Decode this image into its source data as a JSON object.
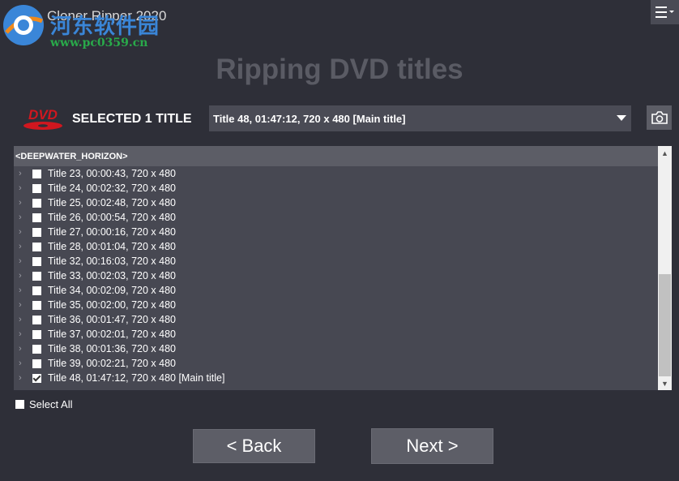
{
  "app": {
    "title": "Cloner Ripper 2020",
    "watermark_cn": "河东软件园",
    "watermark_url": "www.pc0359.cn",
    "menu_icon": "hamburger-menu-icon"
  },
  "page": {
    "heading": "Ripping DVD titles",
    "selected_label": "SELECTED 1 TITLE",
    "dropdown_value": "Title 48, 01:47:12, 720 x 480 [Main title]",
    "camera_icon": "camera-icon",
    "dvd_logo_text": "DVD"
  },
  "list": {
    "header": "<DEEPWATER_HORIZON>",
    "items": [
      {
        "label": "Title 23, 00:00:43, 720 x 480",
        "checked": false
      },
      {
        "label": "Title 24, 00:02:32, 720 x 480",
        "checked": false
      },
      {
        "label": "Title 25, 00:02:48, 720 x 480",
        "checked": false
      },
      {
        "label": "Title 26, 00:00:54, 720 x 480",
        "checked": false
      },
      {
        "label": "Title 27, 00:00:16, 720 x 480",
        "checked": false
      },
      {
        "label": "Title 28, 00:01:04, 720 x 480",
        "checked": false
      },
      {
        "label": "Title 32, 00:16:03, 720 x 480",
        "checked": false
      },
      {
        "label": "Title 33, 00:02:03, 720 x 480",
        "checked": false
      },
      {
        "label": "Title 34, 00:02:09, 720 x 480",
        "checked": false
      },
      {
        "label": "Title 35, 00:02:00, 720 x 480",
        "checked": false
      },
      {
        "label": "Title 36, 00:01:47, 720 x 480",
        "checked": false
      },
      {
        "label": "Title 37, 00:02:01, 720 x 480",
        "checked": false
      },
      {
        "label": "Title 38, 00:01:36, 720 x 480",
        "checked": false
      },
      {
        "label": "Title 39, 00:02:21, 720 x 480",
        "checked": false
      },
      {
        "label": "Title 48, 01:47:12, 720 x 480 [Main title]",
        "checked": true
      }
    ]
  },
  "select_all": {
    "label": "Select All",
    "checked": false
  },
  "buttons": {
    "back": "<  Back",
    "next": "Next  >"
  },
  "colors": {
    "background": "#2e2f38",
    "panel": "#474852",
    "button": "#5d5e67",
    "dvd_red": "#d0171f"
  }
}
